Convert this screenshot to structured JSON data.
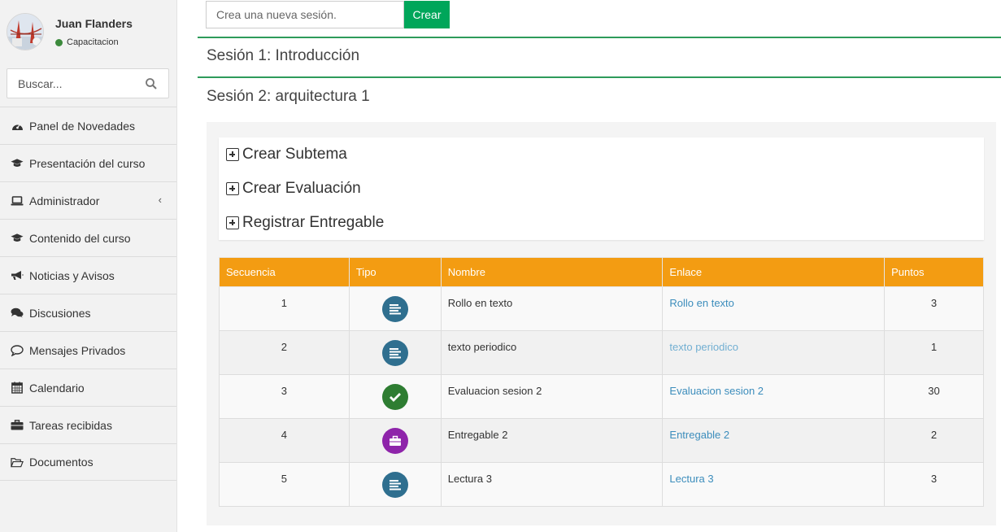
{
  "user": {
    "name": "Juan Flanders",
    "status": "Capacitacion"
  },
  "search": {
    "placeholder": "Buscar..."
  },
  "sidebar": {
    "items": [
      {
        "label": "Panel de Novedades",
        "icon": "dashboard-icon"
      },
      {
        "label": "Presentación del curso",
        "icon": "graduation-cap-icon"
      },
      {
        "label": "Administrador",
        "icon": "laptop-icon"
      },
      {
        "label": "Contenido del curso",
        "icon": "graduation-cap-icon"
      },
      {
        "label": "Noticias y Avisos",
        "icon": "bullhorn-icon"
      },
      {
        "label": "Discusiones",
        "icon": "comments-icon"
      },
      {
        "label": "Mensajes Privados",
        "icon": "comment-icon"
      },
      {
        "label": "Calendario",
        "icon": "calendar-icon"
      },
      {
        "label": "Tareas recibidas",
        "icon": "briefcase-icon"
      },
      {
        "label": "Documentos",
        "icon": "folder-open-icon"
      }
    ]
  },
  "new_session": {
    "placeholder": "Crea una nueva sesión.",
    "button": "Crear"
  },
  "sessions": [
    {
      "title": "Sesión 1: Introducción"
    },
    {
      "title": "Sesión 2: arquitectura 1"
    }
  ],
  "actions": {
    "crear_subtema": "Crear Subtema",
    "crear_evaluacion": "Crear Evaluación",
    "registrar_entregable": "Registrar Entregable"
  },
  "table": {
    "headers": [
      "Secuencia",
      "Tipo",
      "Nombre",
      "Enlace",
      "Puntos"
    ],
    "rows": [
      {
        "secuencia": "1",
        "tipo": "lectura",
        "nombre": "Rollo en texto",
        "enlace": "Rollo en texto",
        "puntos": "3"
      },
      {
        "secuencia": "2",
        "tipo": "lectura",
        "nombre": "texto periodico",
        "enlace": "texto periodico",
        "puntos": "1"
      },
      {
        "secuencia": "3",
        "tipo": "evaluacion",
        "nombre": "Evaluacion sesion 2",
        "enlace": "Evaluacion sesion 2",
        "puntos": "30"
      },
      {
        "secuencia": "4",
        "tipo": "entregable",
        "nombre": "Entregable 2",
        "enlace": "Entregable 2",
        "puntos": "2"
      },
      {
        "secuencia": "5",
        "tipo": "lectura",
        "nombre": "Lectura 3",
        "enlace": "Lectura 3",
        "puntos": "3"
      }
    ]
  },
  "colors": {
    "accent_green": "#00a65a",
    "session_border": "#2e9b5a",
    "table_header": "#f39c12",
    "link": "#3c8dbc",
    "lectura_icon": "#2f6f8f",
    "evaluacion_icon": "#2e7d32",
    "entregable_icon": "#8e24aa"
  }
}
